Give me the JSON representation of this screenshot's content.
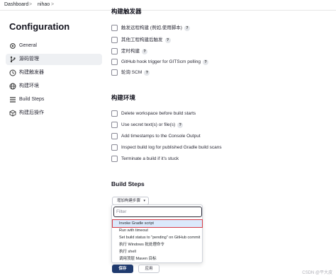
{
  "breadcrumb": {
    "root": "Dashboard",
    "separator": ">",
    "project": "nihao"
  },
  "page": {
    "title": "Configuration"
  },
  "sidebar": {
    "items": [
      {
        "label": "General",
        "icon": "gear-icon",
        "active": false
      },
      {
        "label": "源码管理",
        "icon": "source-branch-icon",
        "active": true
      },
      {
        "label": "构建触发器",
        "icon": "clock-icon",
        "active": false
      },
      {
        "label": "构建环境",
        "icon": "globe-icon",
        "active": false
      },
      {
        "label": "Build Steps",
        "icon": "list-icon",
        "active": false
      },
      {
        "label": "构建后操作",
        "icon": "cube-icon",
        "active": false
      }
    ]
  },
  "triggers": {
    "title": "构建触发器",
    "options": [
      {
        "label": "触发远程构建 (例如,使用脚本)",
        "help": "?"
      },
      {
        "label": "其他工程构建后触发",
        "help": "?"
      },
      {
        "label": "定时构建",
        "help": "?"
      },
      {
        "label": "GitHub hook trigger for GITScm polling",
        "help": "?"
      },
      {
        "label": "轮询 SCM",
        "help": "?"
      }
    ]
  },
  "environment": {
    "title": "构建环境",
    "options": [
      {
        "label": "Delete workspace before build starts"
      },
      {
        "label": "Use secret text(s) or file(s)",
        "help": "?"
      },
      {
        "label": "Add timestamps to the Console Output"
      },
      {
        "label": "Inspect build log for published Gradle build scans"
      },
      {
        "label": "Terminate a build if it's stuck"
      }
    ]
  },
  "build_steps": {
    "title": "Build Steps",
    "add_button": "增加构建步骤",
    "caret": "▾",
    "filter_placeholder": "Filter",
    "menu": [
      {
        "label": "Invoke Gradle script",
        "selected": true
      },
      {
        "label": "Run with timeout",
        "selected": false
      },
      {
        "label": "Set build status to \"pending\" on GitHub commit",
        "selected": false
      },
      {
        "label": "执行 Windows 批处理命令",
        "selected": false
      },
      {
        "label": "执行 shell",
        "selected": false
      },
      {
        "label": "调用顶层 Maven 目标",
        "selected": false
      }
    ]
  },
  "actions": {
    "save": "保存",
    "apply": "应用"
  },
  "watermark": "CSDN @平大皮",
  "colors": {
    "save_button": "#1f3a6e",
    "highlight_outline": "#d63b46",
    "selected_row": "#dbe9fb"
  }
}
